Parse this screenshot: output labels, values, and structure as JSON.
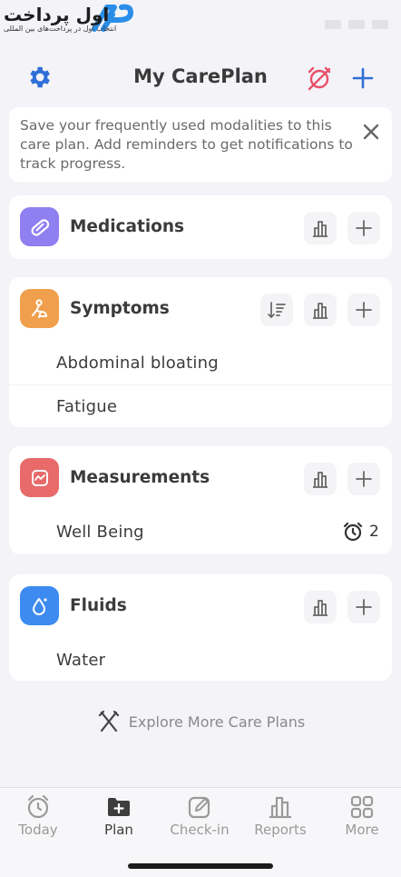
{
  "watermark": {
    "brand_text": "اول پرداخت",
    "subtitle": "انتخاب اول در پرداخت‌های بین المللی"
  },
  "header": {
    "title": "My CarePlan",
    "icons": [
      "gear-icon",
      "notifications-off-icon",
      "plus-icon"
    ]
  },
  "banner": {
    "text": "Save your frequently used modalities to this care plan. Add reminders to get notifications to track progress."
  },
  "categories": [
    {
      "title": "Medications",
      "icon": "pill-icon",
      "color": "#8f7ff0",
      "items": []
    },
    {
      "title": "Symptoms",
      "icon": "body-icon",
      "color": "#f0a04d",
      "items": [
        "Abdominal bloating",
        "Fatigue"
      ]
    },
    {
      "title": "Measurements",
      "icon": "gauge-icon",
      "color": "#e86a6a",
      "items": [
        {
          "label": "Well Being",
          "reminder_count": "2"
        }
      ]
    },
    {
      "title": "Fluids",
      "icon": "drop-icon",
      "color": "#3d8bf0",
      "items": [
        "Water"
      ]
    }
  ],
  "explore": {
    "label": "Explore More Care Plans"
  },
  "tabbar": {
    "active": "Plan",
    "tabs": [
      {
        "label": "Today",
        "icon": "clock-icon"
      },
      {
        "label": "Plan",
        "icon": "folder-plus-icon"
      },
      {
        "label": "Check-in",
        "icon": "edit-icon"
      },
      {
        "label": "Reports",
        "icon": "bar-chart-icon"
      },
      {
        "label": "More",
        "icon": "grid-icon"
      }
    ]
  },
  "colors": {
    "accent": "#2f6fd6",
    "no_sound": "#e8506a",
    "background": "#f3f3f8"
  }
}
